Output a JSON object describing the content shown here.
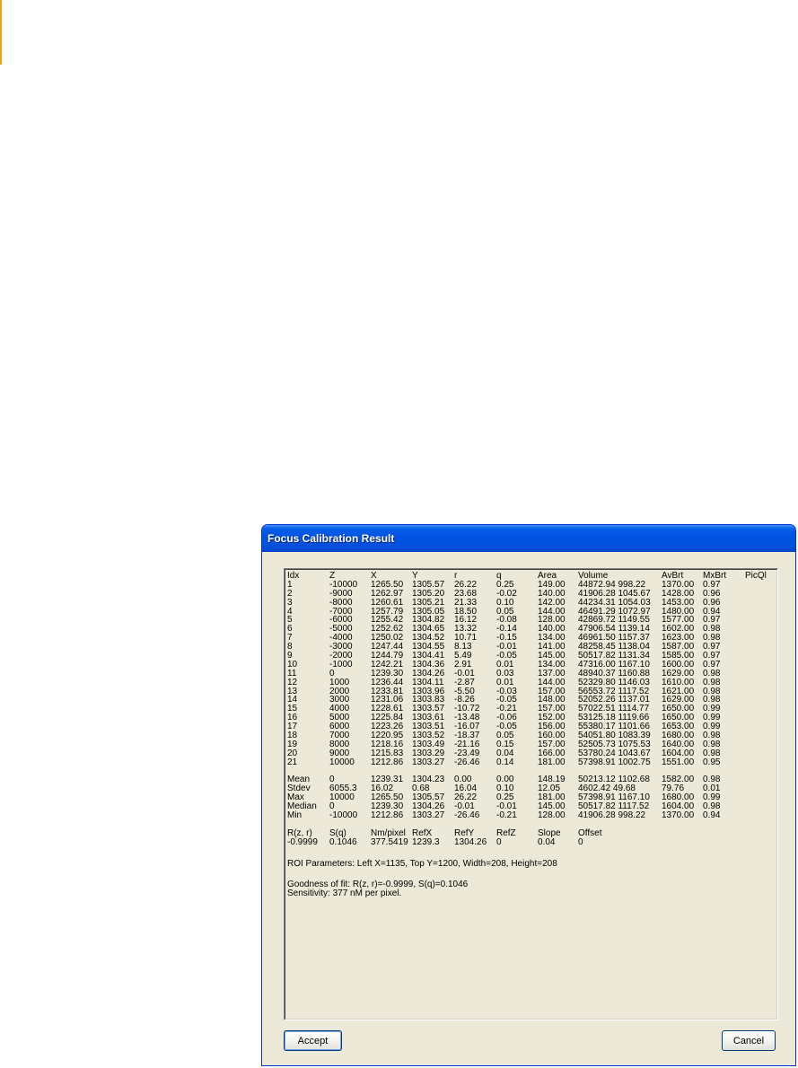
{
  "window": {
    "title": "Focus Calibration Result"
  },
  "table": {
    "headers": [
      "Idx",
      "Z",
      "X",
      "Y",
      "r",
      "q",
      "Area",
      "Volume",
      "AvBrt",
      "MxBrt",
      "PicQl"
    ],
    "rows": [
      [
        "1",
        "-10000",
        "1265.50",
        "1305.57",
        "26.22",
        "0.25",
        "149.00",
        "44872.94 998.22",
        "1370.00",
        "0.97",
        ""
      ],
      [
        "2",
        "-9000",
        "1262.97",
        "1305.20",
        "23.68",
        "-0.02",
        "140.00",
        "41906.28 1045.67",
        "1428.00",
        "0.96",
        ""
      ],
      [
        "3",
        "-8000",
        "1260.61",
        "1305.21",
        "21.33",
        "0.10",
        "142.00",
        "44234.31 1054.03",
        "1453.00",
        "0.96",
        ""
      ],
      [
        "4",
        "-7000",
        "1257.79",
        "1305.05",
        "18.50",
        "0.05",
        "144.00",
        "46491.29 1072.97",
        "1480.00",
        "0.94",
        ""
      ],
      [
        "5",
        "-6000",
        "1255.42",
        "1304.82",
        "16.12",
        "-0.08",
        "128.00",
        "42869.72 1149.55",
        "1577.00",
        "0.97",
        ""
      ],
      [
        "6",
        "-5000",
        "1252.62",
        "1304.65",
        "13.32",
        "-0.14",
        "140.00",
        "47906.54 1139.14",
        "1602.00",
        "0.98",
        ""
      ],
      [
        "7",
        "-4000",
        "1250.02",
        "1304.52",
        "10.71",
        "-0.15",
        "134.00",
        "46961.50 1157.37",
        "1623.00",
        "0.98",
        ""
      ],
      [
        "8",
        "-3000",
        "1247.44",
        "1304.55",
        "8.13",
        "-0.01",
        "141.00",
        "48258.45 1138.04",
        "1587.00",
        "0.97",
        ""
      ],
      [
        "9",
        "-2000",
        "1244.79",
        "1304.41",
        "5.49",
        "-0.05",
        "145.00",
        "50517.82 1131.34",
        "1585.00",
        "0.97",
        ""
      ],
      [
        "10",
        "-1000",
        "1242.21",
        "1304.36",
        "2.91",
        "0.01",
        "134.00",
        "47316.00 1167.10",
        "1600.00",
        "0.97",
        ""
      ],
      [
        "11",
        "0",
        "1239.30",
        "1304.26",
        "-0.01",
        "0.03",
        "137.00",
        "48940.37 1160.88",
        "1629.00",
        "0.98",
        ""
      ],
      [
        "12",
        "1000",
        "1236.44",
        "1304.11",
        "-2.87",
        "0.01",
        "144.00",
        "52329.80 1146.03",
        "1610.00",
        "0.98",
        ""
      ],
      [
        "13",
        "2000",
        "1233.81",
        "1303.96",
        "-5.50",
        "-0.03",
        "157.00",
        "56553.72 1117.52",
        "1621.00",
        "0.98",
        ""
      ],
      [
        "14",
        "3000",
        "1231.06",
        "1303.83",
        "-8.26",
        "-0.05",
        "148.00",
        "52052.26 1137.01",
        "1629.00",
        "0.98",
        ""
      ],
      [
        "15",
        "4000",
        "1228.61",
        "1303.57",
        "-10.72",
        "-0.21",
        "157.00",
        "57022.51 1114.77",
        "1650.00",
        "0.99",
        ""
      ],
      [
        "16",
        "5000",
        "1225.84",
        "1303.61",
        "-13.48",
        "-0.06",
        "152.00",
        "53125.18 1119.66",
        "1650.00",
        "0.99",
        ""
      ],
      [
        "17",
        "6000",
        "1223.26",
        "1303.51",
        "-16.07",
        "-0.05",
        "156.00",
        "55380.17 1101.66",
        "1653.00",
        "0.99",
        ""
      ],
      [
        "18",
        "7000",
        "1220.95",
        "1303.52",
        "-18.37",
        "0.05",
        "160.00",
        "54051.80 1083.39",
        "1680.00",
        "0.98",
        ""
      ],
      [
        "19",
        "8000",
        "1218.16",
        "1303.49",
        "-21.16",
        "0.15",
        "157.00",
        "52505.73 1075.53",
        "1640.00",
        "0.98",
        ""
      ],
      [
        "20",
        "9000",
        "1215.83",
        "1303.29",
        "-23.49",
        "0.04",
        "166.00",
        "53780.24 1043.67",
        "1604.00",
        "0.98",
        ""
      ],
      [
        "21",
        "10000",
        "1212.86",
        "1303.27",
        "-26.46",
        "0.14",
        "181.00",
        "57398.91 1002.75",
        "1551.00",
        "0.95",
        ""
      ]
    ],
    "stats": [
      [
        "Mean",
        "0",
        "1239.31",
        "1304.23",
        "0.00",
        "0.00",
        "148.19",
        "50213.12 1102.68",
        "1582.00",
        "0.98",
        ""
      ],
      [
        "Stdev",
        "6055.3",
        "16.02",
        "0.68",
        "16.04",
        "0.10",
        "12.05",
        "4602.42  49.68",
        "79.76",
        "0.01",
        ""
      ],
      [
        "Max",
        "10000",
        "1265.50",
        "1305.57",
        "26.22",
        "0.25",
        "181.00",
        "57398.91 1167.10",
        "1680.00",
        "0.99",
        ""
      ],
      [
        "Median",
        "0",
        "1239.30",
        "1304.26",
        "-0.01",
        "-0.01",
        "145.00",
        "50517.82 1117.52",
        "1604.00",
        "0.98",
        ""
      ],
      [
        "Min",
        "-10000",
        "1212.86",
        "1303.27",
        "-26.46",
        "-0.21",
        "128.00",
        "41906.28 998.22",
        "1370.00",
        "0.94",
        ""
      ]
    ]
  },
  "params": {
    "headers": [
      "R(z, r)",
      "S(q)",
      "Nm/pixel",
      "RefX",
      "RefY",
      "RefZ",
      "Slope",
      "Offset"
    ],
    "values": [
      "-0.9999",
      "0.1046",
      "377.5419",
      "1239.3",
      "1304.26",
      "0",
      "0.04",
      "0"
    ]
  },
  "roi_text": "ROI Parameters: Left X=1135, Top Y=1200, Width=208, Height=208",
  "goodness_text": "Goodness of fit: R(z, r)=-0.9999, S(q)=0.1046",
  "sensitivity_text": "Sensitivity: 377 nM per pixel.",
  "buttons": {
    "accept": "Accept",
    "cancel": "Cancel"
  }
}
